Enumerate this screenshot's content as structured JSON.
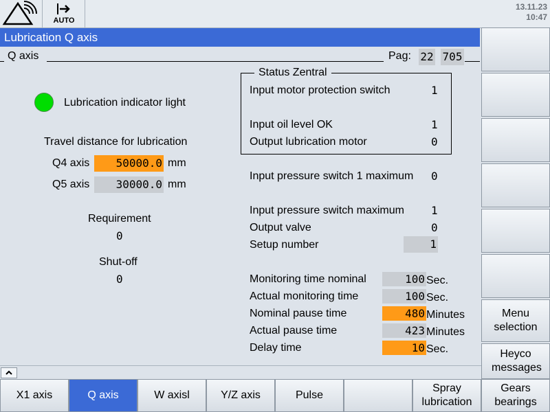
{
  "header": {
    "mode_label": "AUTO",
    "date": "13.11.23",
    "time": "10:47",
    "icons": [
      "machine-alarm-icon",
      "auto-mode-icon"
    ]
  },
  "title": "Lubrication Q axis",
  "section": {
    "label": "Q axis",
    "page_label": "Pag:",
    "page_no": "22",
    "page_code": "705"
  },
  "left": {
    "indicator_label": "Lubrication indicator light",
    "indicator_color": "#00dd00",
    "travel_heading": "Travel distance for lubrication",
    "q4_label": "Q4 axis",
    "q4_value": "50000.0",
    "q4_unit": "mm",
    "q5_label": "Q5 axis",
    "q5_value": "30000.0",
    "q5_unit": "mm",
    "requirement_label": "Requirement",
    "requirement_value": "0",
    "shutoff_label": "Shut-off",
    "shutoff_value": "0"
  },
  "status": {
    "title": "Status Zentral",
    "motor_protection_label": "Input motor protection switch",
    "motor_protection_value": "1",
    "oil_level_label": "Input oil level OK",
    "oil_level_value": "1",
    "lub_motor_label": "Output lubrication motor",
    "lub_motor_value": "0"
  },
  "right": {
    "pressure1_label": "Input pressure switch 1 maximum",
    "pressure1_value": "0",
    "pressure_label": "Input pressure switch maximum",
    "pressure_value": "1",
    "valve_label": "Output valve",
    "valve_value": "0",
    "setup_label": "Setup number",
    "setup_value": "1",
    "mon_nominal_label": "Monitoring time nominal",
    "mon_nominal_value": "100",
    "mon_nominal_unit": "Sec.",
    "mon_actual_label": "Actual monitoring time",
    "mon_actual_value": "100",
    "mon_actual_unit": "Sec.",
    "pause_nominal_label": "Nominal pause time",
    "pause_nominal_value": "480",
    "pause_nominal_unit": "Minutes",
    "pause_actual_label": "Actual pause time",
    "pause_actual_value": "423",
    "pause_actual_unit": "Minutes",
    "delay_label": "Delay time",
    "delay_value": "10",
    "delay_unit": "Sec."
  },
  "softkeys": {
    "menu_selection": "Menu selection",
    "heyco_messages": "Heyco messages"
  },
  "tabs": {
    "x1": "X1 axis",
    "q": "Q axis",
    "w": "W axisl",
    "yz": "Y/Z axis",
    "pulse": "Pulse",
    "empty": "",
    "spray": "Spray lubrication",
    "gears": "Gears bearings"
  },
  "colors": {
    "accent": "#3b6ad6",
    "highlight": "#ff9a17",
    "field": "#c9cdd2"
  }
}
